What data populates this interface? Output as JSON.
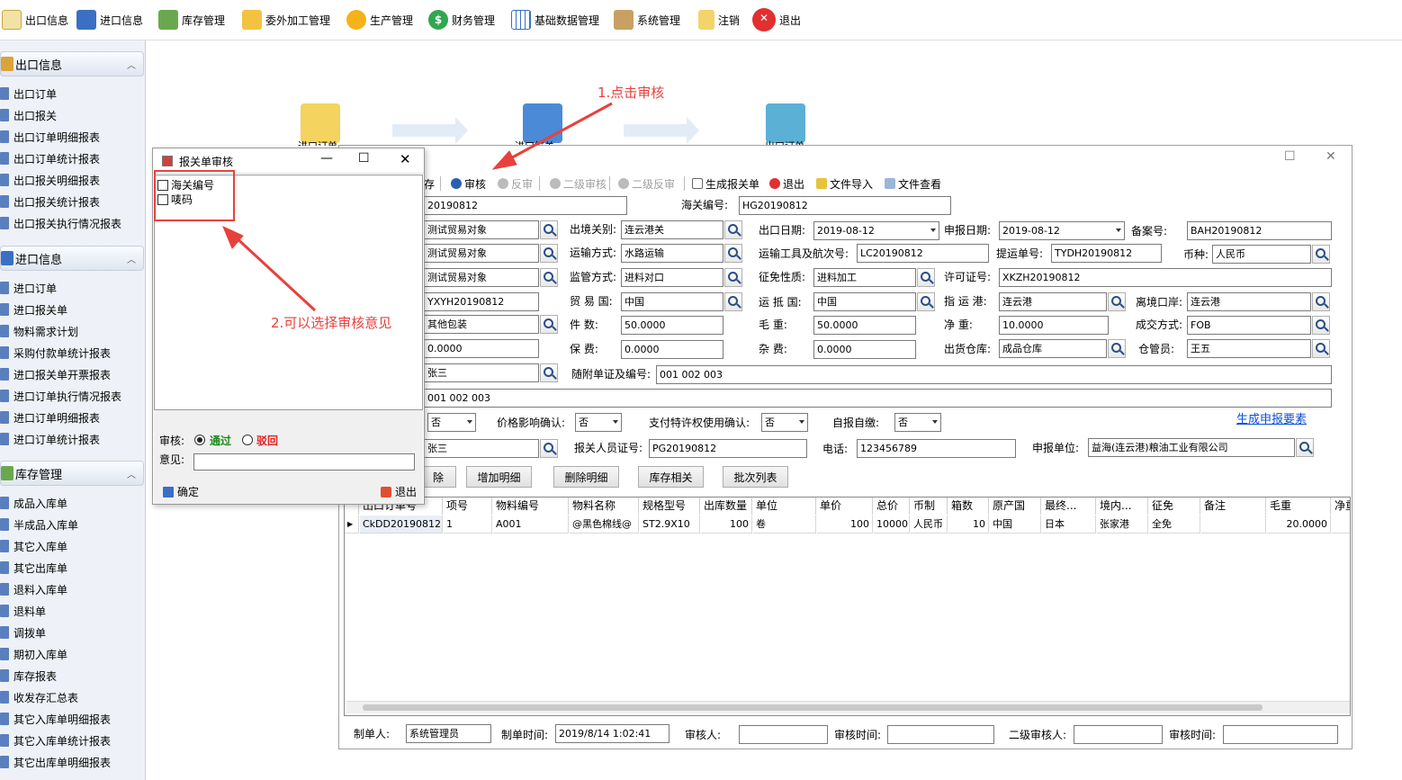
{
  "toolbar": {
    "items": [
      {
        "label": "出口信息",
        "icon": "edit-doc-icon"
      },
      {
        "label": "进口信息",
        "icon": "inbox-tray-icon"
      },
      {
        "label": "库存管理",
        "icon": "warehouse-icon"
      },
      {
        "label": "委外加工管理",
        "icon": "folder-arrow-icon"
      },
      {
        "label": "生产管理",
        "icon": "gear-icon"
      },
      {
        "label": "财务管理",
        "icon": "dollar-icon"
      },
      {
        "label": "基础数据管理",
        "icon": "table-grid-icon"
      },
      {
        "label": "系统管理",
        "icon": "tools-icon"
      },
      {
        "label": "注销",
        "icon": "key-icon"
      },
      {
        "label": "退出",
        "icon": "close-circle-icon"
      }
    ]
  },
  "sidebar": {
    "sections": [
      {
        "title": "出口信息",
        "items": [
          "出口订单",
          "出口报关",
          "出口订单明细报表",
          "出口订单统计报表",
          "出口报关明细报表",
          "出口报关统计报表",
          "出口报关执行情况报表"
        ]
      },
      {
        "title": "进口信息",
        "items": [
          "进口订单",
          "进口报关单",
          "物料需求计划",
          "采购付款单统计报表",
          "进口报关单开票报表",
          "进口订单执行情况报表",
          "进口订单明细报表",
          "进口订单统计报表"
        ]
      },
      {
        "title": "库存管理",
        "items": [
          "成品入库单",
          "半成品入库单",
          "其它入库单",
          "其它出库单",
          "退料入库单",
          "退料单",
          "调拨单",
          "期初入库单",
          "库存报表",
          "收发存汇总表",
          "其它入库单明细报表",
          "其它入库单统计报表",
          "其它出库单明细报表"
        ]
      }
    ]
  },
  "flow": {
    "labels": [
      "进口订单",
      "进口报关",
      "出口订单"
    ]
  },
  "mainwin": {
    "toolbar": {
      "save": "存",
      "audit": "审核",
      "unaudit": "反审",
      "audit2": "二级审核",
      "unaudit2": "二级反审",
      "gen": "生成报关单",
      "exit": "退出",
      "import": "文件导入",
      "view": "文件查看"
    },
    "form": {
      "order_no": "20190812",
      "customs_no_label": "海关编号:",
      "customs_no": "HG20190812",
      "obj1": "测试贸易对象",
      "obj2": "测试贸易对象",
      "obj3": "测试贸易对象",
      "port_label": "出境关别:",
      "port": "连云港关",
      "export_date_label": "出口日期:",
      "export_date": "2019-08-12",
      "declare_date_label": "申报日期:",
      "declare_date": "2019-08-12",
      "record_no_label": "备案号:",
      "record_no": "BAH20190812",
      "transport_label": "运输方式:",
      "transport": "水路运输",
      "vessel_label": "运输工具及航次号:",
      "vessel": "LC20190812",
      "bill_label": "提运单号:",
      "bill": "TYDH20190812",
      "currency_label": "币种:",
      "currency": "人民币",
      "supervise_label": "监管方式:",
      "supervise": "进料对口",
      "levy_label": "征免性质:",
      "levy": "进料加工",
      "license_label": "许可证号:",
      "license": "XKZH20190812",
      "yxyh": "YXYH20190812",
      "trade_country_label": "贸 易 国:",
      "trade_country": "中国",
      "dest_country_label": "运 抵 国:",
      "dest_country": "中国",
      "dest_port_label": "指 运 港:",
      "dest_port": "连云港",
      "depart_port_label": "离境口岸:",
      "depart_port": "连云港",
      "package": "其他包装",
      "pieces_label": "件      数:",
      "pieces": "50.0000",
      "gross_label": "毛      重:",
      "gross": "50.0000",
      "net_label": "净      重:",
      "net": "10.0000",
      "deal_label": "成交方式:",
      "deal": "FOB",
      "freight": "0.0000",
      "insurance_label": "保      费:",
      "insurance": "0.0000",
      "misc_label": "杂      费:",
      "misc": "0.0000",
      "warehouse_label": "出货仓库:",
      "warehouse": "成品仓库",
      "keeper_label": "仓管员:",
      "keeper": "王五",
      "person": "张三",
      "docs_label": "随附单证及编号:",
      "docs": "001 002 003",
      "marks": "001 002 003",
      "special": "否",
      "price_label": "价格影响确认:",
      "price": "否",
      "royalty_label": "支付特许权使用确认:",
      "royalty": "否",
      "self_label": "自报自缴:",
      "self": "否",
      "gen_elements": "生成申报要素",
      "declarer": "张三",
      "declarer_cert_label": "报关人员证号:",
      "declarer_cert": "PG20190812",
      "phone_label": "电话:",
      "phone": "123456789",
      "unit_label": "申报单位:",
      "unit": "益海(连云港)粮油工业有限公司"
    },
    "buttons": {
      "del": "除",
      "add": "增加明细",
      "remove": "删除明细",
      "stock": "库存相关",
      "batch": "批次列表"
    },
    "grid": {
      "headers": [
        "出口订单号",
        "项号",
        "物料编号",
        "物料名称",
        "规格型号",
        "出库数量",
        "单位",
        "单价",
        "总价",
        "币制",
        "箱数",
        "原产国",
        "最终...",
        "境内...",
        "征免",
        "备注",
        "毛重",
        "净重"
      ],
      "rows": [
        [
          "CkDD20190812",
          "1",
          "A001",
          "@黑色棉线@",
          "ST2.9X10",
          "100",
          "卷",
          "100",
          "10000",
          "人民币",
          "10",
          "中国",
          "日本",
          "张家港",
          "全免",
          "",
          "20.0000",
          ""
        ]
      ]
    },
    "footer": {
      "maker_label": "制单人:",
      "maker": "系统管理员",
      "make_time_label": "制单时间:",
      "make_time": "2019/8/14 1:02:41",
      "auditor_label": "审核人:",
      "auditor": "",
      "audit_time_label": "审核时间:",
      "audit_time": "",
      "auditor2_label": "二级审核人:",
      "auditor2": "",
      "audit_time2_label": "审核时间:",
      "audit_time2": ""
    }
  },
  "dialog": {
    "title": "报关单审核",
    "checks": [
      "海关编号",
      "唛码"
    ],
    "audit_label": "审核:",
    "pass": "通过",
    "reject": "驳回",
    "opinion_label": "意见:",
    "opinion": "",
    "ok": "确定",
    "exit": "退出"
  },
  "annotations": {
    "a1": "1.点击审核",
    "a2": "2.可以选择审核意见"
  },
  "colors": {
    "accent_red": "#e8413c",
    "pass_green": "#1a8a1a",
    "reject_red": "#e02020",
    "link_blue": "#0b4fd6"
  }
}
